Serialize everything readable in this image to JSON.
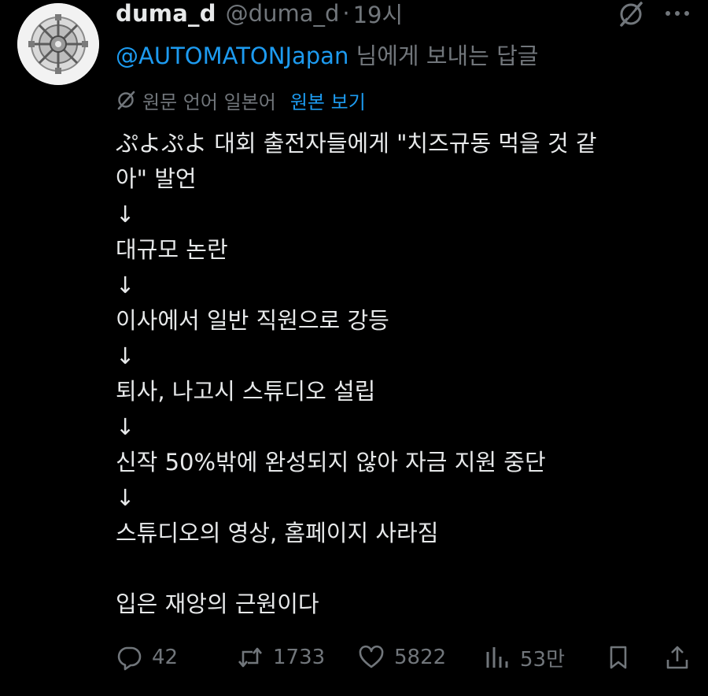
{
  "tweet": {
    "display_name": "duma_d",
    "handle": "@duma_d",
    "separator": "·",
    "time": "19시",
    "reply_to": {
      "mention": "@AUTOMATONJapan",
      "suffix": " 님에게 보내는 답글"
    },
    "translation": {
      "text": "원문 언어 일본어",
      "show_original": "원본 보기"
    },
    "body_lines": [
      "ぷよぷよ 대회 출전자들에게 \"치즈규동 먹을 것 같",
      "아\" 발언",
      "↓",
      "대규모 논란",
      "↓",
      "이사에서 일반 직원으로 강등",
      "↓",
      "퇴사, 나고시 스튜디오 설립",
      "↓",
      "신작 50%밖에 완성되지 않아 자금 지원 중단",
      "↓",
      "스튜디오의 영상, 홈페이지 사라짐",
      "",
      "입은 재앙의 근원이다"
    ],
    "actions": {
      "replies": "42",
      "reposts": "1733",
      "likes": "5822",
      "views": "53만"
    }
  },
  "icons": {
    "grok": "grok-icon",
    "more": "more-icon",
    "translate": "translate-icon",
    "reply": "reply-icon",
    "repost": "repost-icon",
    "like": "like-icon",
    "views": "views-icon",
    "bookmark": "bookmark-icon",
    "share": "share-icon"
  },
  "colors": {
    "background": "#000000",
    "text": "#e7e9ea",
    "muted": "#71767b",
    "link": "#1d9bf0"
  }
}
